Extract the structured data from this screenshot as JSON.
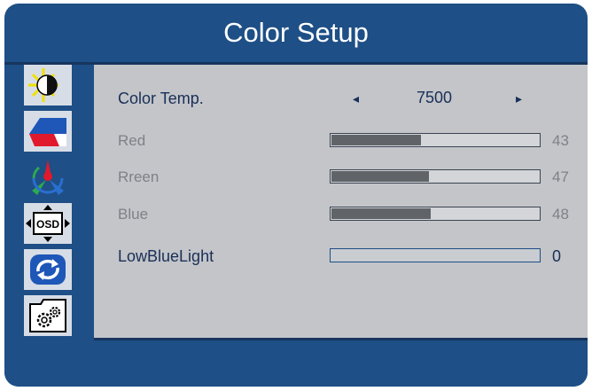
{
  "title": "Color Setup",
  "sidebar": {
    "tabs": [
      {
        "icon": "brightness-contrast-icon"
      },
      {
        "icon": "image-mode-icon"
      },
      {
        "icon": "color-setup-icon",
        "active": true
      },
      {
        "icon": "osd-position-icon"
      },
      {
        "icon": "reset-icon"
      },
      {
        "icon": "settings-gears-icon"
      }
    ]
  },
  "color_temp": {
    "label": "Color Temp.",
    "value": "7500",
    "left_arrow": "◂",
    "right_arrow": "▸"
  },
  "sliders": [
    {
      "label": "Red",
      "value": "43",
      "fill": 0.43
    },
    {
      "label": "Rreen",
      "value": "47",
      "fill": 0.47
    },
    {
      "label": "Blue",
      "value": "48",
      "fill": 0.48
    }
  ],
  "low_blue_light": {
    "label": "LowBlueLight",
    "value": "0",
    "fill": 0
  },
  "colors": {
    "frame": "#1e4f86",
    "panel": "#c3c5c9",
    "bar_fill": "#606469"
  }
}
